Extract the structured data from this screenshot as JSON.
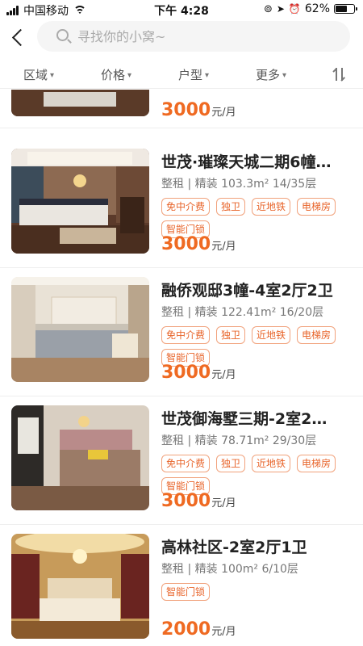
{
  "status_bar": {
    "carrier": "中国移动",
    "time": "下午 4:28",
    "battery": "62%",
    "battery_level": 0.62
  },
  "search": {
    "placeholder": "寻找你的小窝~"
  },
  "filters": [
    {
      "label": "区域"
    },
    {
      "label": "价格"
    },
    {
      "label": "户型"
    },
    {
      "label": "更多"
    }
  ],
  "listings": [
    {
      "price": "3000",
      "unit": "元/月"
    },
    {
      "title": "世茂·璀璨天城二期6幢…",
      "meta": "整租 | 精装 103.3m² 14/35层",
      "tags": [
        "免中介费",
        "独卫",
        "近地铁",
        "电梯房",
        "智能门锁"
      ],
      "price": "3000",
      "unit": "元/月"
    },
    {
      "title": "融侨观邸3幢-4室2厅2卫",
      "meta": "整租 | 精装 122.41m² 16/20层",
      "tags": [
        "免中介费",
        "独卫",
        "近地铁",
        "电梯房",
        "智能门锁"
      ],
      "price": "3000",
      "unit": "元/月"
    },
    {
      "title": "世茂御海墅三期-2室2…",
      "meta": "整租 | 精装 78.71m² 29/30层",
      "tags": [
        "免中介费",
        "独卫",
        "近地铁",
        "电梯房",
        "智能门锁"
      ],
      "price": "3000",
      "unit": "元/月"
    },
    {
      "title": "高林社区-2室2厅1卫",
      "meta": "整租 | 精装 100m² 6/10层",
      "tags": [
        "智能门锁"
      ],
      "price": "2000",
      "unit": "元/月"
    }
  ]
}
